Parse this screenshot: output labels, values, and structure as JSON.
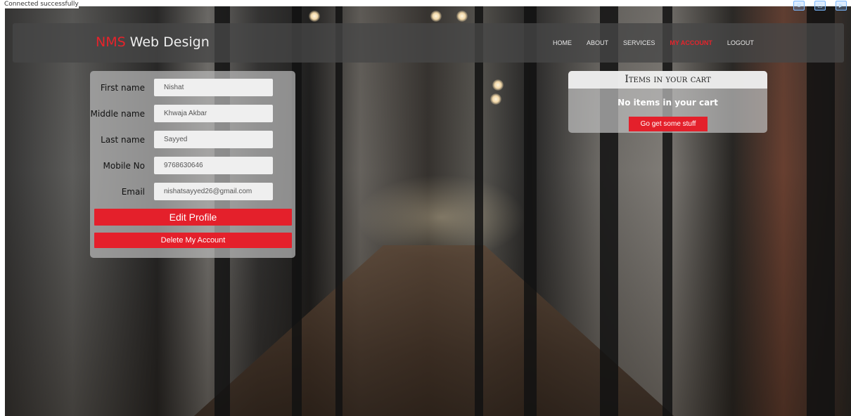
{
  "status": {
    "text": "Connected successfully"
  },
  "navbar": {
    "brand_accent": "NMS",
    "brand_rest": "Web Design",
    "items": [
      {
        "label": "HOME",
        "active": false
      },
      {
        "label": "ABOUT",
        "active": false
      },
      {
        "label": "SERVICES",
        "active": false
      },
      {
        "label": "MY ACCOUNT",
        "active": true
      },
      {
        "label": "LOGOUT",
        "active": false
      }
    ]
  },
  "profile": {
    "fields": [
      {
        "label": "First name",
        "value": "Nishat"
      },
      {
        "label": "Middle name",
        "value": "Khwaja Akbar"
      },
      {
        "label": "Last name",
        "value": "Sayyed"
      },
      {
        "label": "Mobile No",
        "value": "9768630646"
      },
      {
        "label": "Email",
        "value": "nishatsayyed26@gmail.com"
      }
    ],
    "edit_label": "Edit Profile",
    "delete_label": "Delete My Account"
  },
  "cart": {
    "title": "Items in your cart",
    "empty_text": "No items in your cart",
    "button_label": "Go get some stuff"
  },
  "colors": {
    "accent": "#e4202b",
    "navbar_bg": "#464646"
  }
}
